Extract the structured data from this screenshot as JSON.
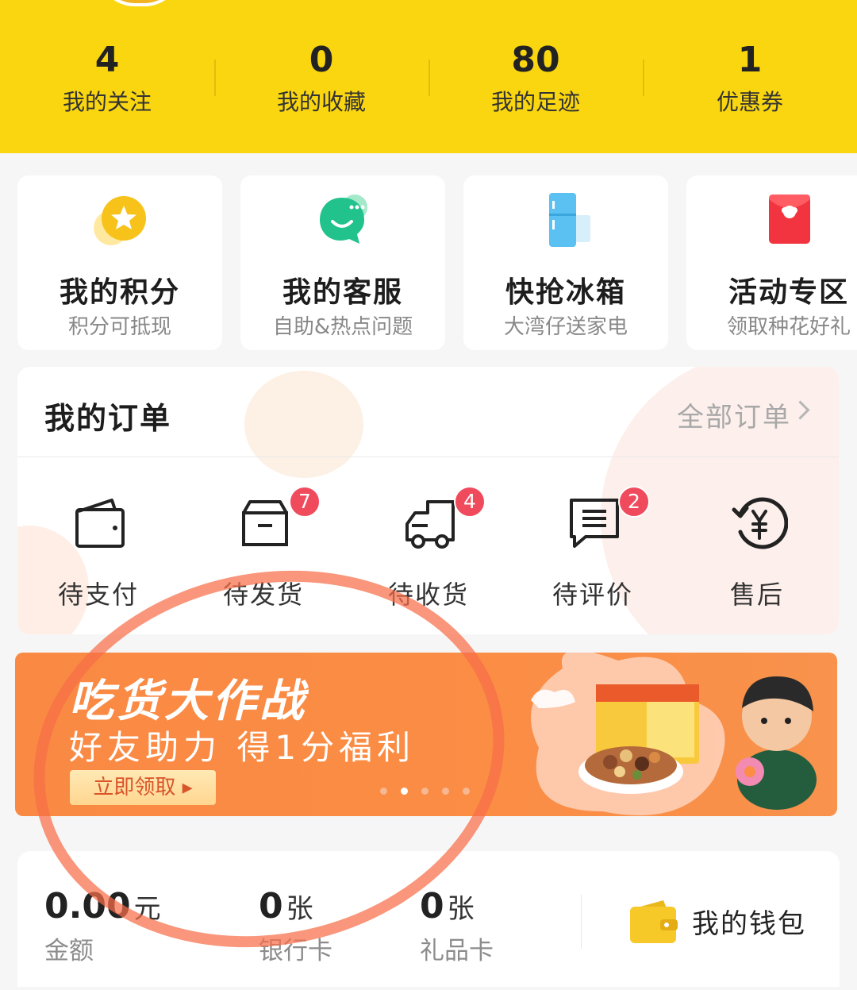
{
  "stats": [
    {
      "value": "4",
      "label": "我的关注"
    },
    {
      "value": "0",
      "label": "我的收藏"
    },
    {
      "value": "80",
      "label": "我的足迹"
    },
    {
      "value": "1",
      "label": "优惠券"
    }
  ],
  "cards": [
    {
      "title": "我的积分",
      "sub": "积分可抵现",
      "icon": "points-star-icon"
    },
    {
      "title": "我的客服",
      "sub": "自助&热点问题",
      "icon": "chat-bubble-icon"
    },
    {
      "title": "快抢冰箱",
      "sub": "大湾仔送家电",
      "icon": "fridge-icon"
    },
    {
      "title": "活动专区",
      "sub": "领取种花好礼",
      "icon": "red-envelope-icon"
    }
  ],
  "orders": {
    "title": "我的订单",
    "all_link": "全部订单",
    "items": [
      {
        "label": "待支付",
        "badge": ""
      },
      {
        "label": "待发货",
        "badge": "7"
      },
      {
        "label": "待收货",
        "badge": "4"
      },
      {
        "label": "待评价",
        "badge": "2"
      },
      {
        "label": "售后",
        "badge": ""
      }
    ]
  },
  "banner": {
    "title": "吃货大作战",
    "subtitle": "好友助力 得1分福利",
    "button": "立即领取",
    "slide_count": 5,
    "active_slide": 2
  },
  "wallet": {
    "amount": {
      "value": "0.00",
      "unit": "元",
      "label": "金额"
    },
    "bank_cards": {
      "value": "0",
      "unit": "张",
      "label": "银行卡"
    },
    "gift_cards": {
      "value": "0",
      "unit": "张",
      "label": "礼品卡"
    },
    "my_wallet": "我的钱包"
  },
  "colors": {
    "header_yellow": "#fad610",
    "badge_red": "#f04a5d",
    "banner_orange": "#fb8d45",
    "annotation_circle": "#f66e48"
  }
}
